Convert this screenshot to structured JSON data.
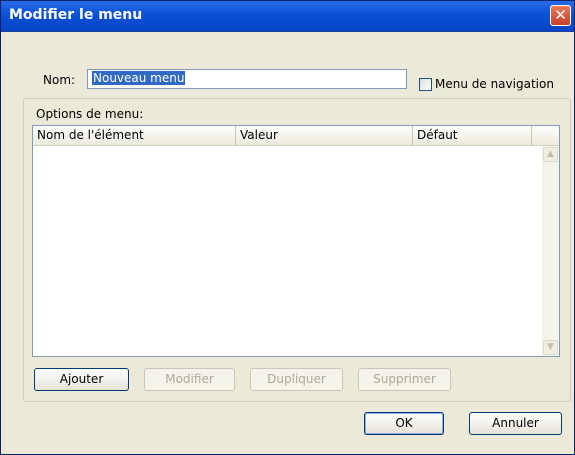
{
  "window": {
    "title": "Modifier le menu"
  },
  "form": {
    "name_label": "Nom:",
    "name_value": "Nouveau menu",
    "nav_checkbox_label": "Menu de navigation",
    "nav_checkbox_checked": false,
    "options_label": "Options de menu:"
  },
  "list": {
    "columns": [
      "Nom de l'élément",
      "Valeur",
      "Défaut"
    ],
    "rows": []
  },
  "buttons": {
    "add": "Ajouter",
    "modify": "Modifier",
    "duplicate": "Dupliquer",
    "delete": "Supprimer",
    "ok": "OK",
    "cancel": "Annuler"
  },
  "icons": {
    "close": "close-icon",
    "scroll_up": "chevron-up-icon",
    "scroll_down": "chevron-down-icon"
  }
}
